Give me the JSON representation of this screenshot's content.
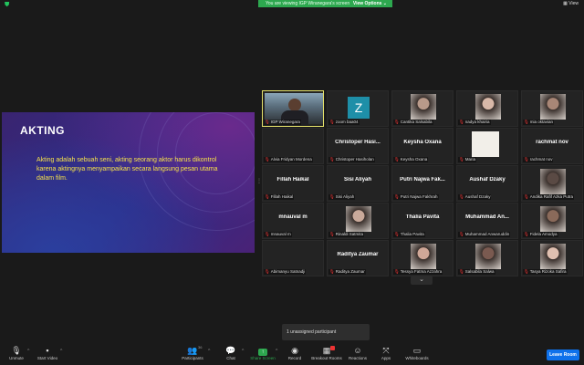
{
  "topbar": {
    "banner_text": "You are viewing IGP Wiranegara's screen",
    "view_options": "View Options ⌄",
    "view_label": "View"
  },
  "slide": {
    "title": "AKTING",
    "body": "Akting adalah sebuah seni, akting seorang aktor harus dikontrol karena aktingnya menyampaikan secara langsung pesan utama dalam film."
  },
  "participants": [
    {
      "name": "IGP Wiranegara",
      "big": "",
      "kind": "cam"
    },
    {
      "name": "zoom baa04",
      "big": "",
      "kind": "z"
    },
    {
      "name": "Cantika Salsabila",
      "big": "",
      "kind": "photo"
    },
    {
      "name": "nadya khairia",
      "big": "",
      "kind": "photo"
    },
    {
      "name": "mia oktavian",
      "big": "",
      "kind": "photo"
    },
    {
      "name": "Alvia Fridyan Mordena",
      "big": "",
      "kind": "blank"
    },
    {
      "name": "Christoper Hasiholan",
      "big": "Christoper Hasi...",
      "kind": "text"
    },
    {
      "name": "Keysha Oxana",
      "big": "Keysha Oxana",
      "kind": "text"
    },
    {
      "name": "Maria",
      "big": "",
      "kind": "photo-light"
    },
    {
      "name": "rachmat nov",
      "big": "rachmat nov",
      "kind": "text"
    },
    {
      "name": "Fillah Haikal",
      "big": "Fillah Haikal",
      "kind": "text"
    },
    {
      "name": "Sisi Aliyah",
      "big": "Sisi Aliyah",
      "kind": "text"
    },
    {
      "name": "Putri Najwa Fakhrah",
      "big": "Putri Najwa Fak...",
      "kind": "text"
    },
    {
      "name": "Aushaf Dzaky",
      "big": "Aushaf Dzaky",
      "kind": "text"
    },
    {
      "name": "Andika Rafif Azka Putra",
      "big": "",
      "kind": "photo"
    },
    {
      "name": "mnauval m",
      "big": "mnauval m",
      "kind": "text"
    },
    {
      "name": "Rinaldi Satmita",
      "big": "",
      "kind": "photo"
    },
    {
      "name": "Thalia Pavita",
      "big": "Thalia Pavita",
      "kind": "text"
    },
    {
      "name": "Muhammad Anwaruddin",
      "big": "Muhammad An...",
      "kind": "text"
    },
    {
      "name": "Fidela Amodya",
      "big": "",
      "kind": "photo"
    },
    {
      "name": "Abimanyu Satnadji",
      "big": "",
      "kind": "blank"
    },
    {
      "name": "Raditya Zaumar",
      "big": "Raditya Zaumar",
      "kind": "text"
    },
    {
      "name": "Tessya Fatma Azzahra",
      "big": "",
      "kind": "photo"
    },
    {
      "name": "Salsabila Salwa",
      "big": "",
      "kind": "photo"
    },
    {
      "name": "Tasya Rizoka Safira",
      "big": "",
      "kind": "photo"
    }
  ],
  "toast": "1 unassigned participant",
  "toolbar": {
    "unmute": "Unmute",
    "start_video": "Start Video",
    "participants": "Participants",
    "participant_count": "36",
    "chat": "Chat",
    "share_screen": "Share Screen",
    "record": "Record",
    "breakout_rooms": "Breakout Rooms",
    "reactions": "Reactions",
    "apps": "Apps",
    "whiteboards": "Whiteboards",
    "leave": "Leave Room",
    "accent_share": "#2da84f",
    "accent_leave": "#0e71eb"
  },
  "icons": [
    "shield-icon",
    "mic-muted-icon",
    "video-off-icon",
    "participants-icon",
    "chat-icon",
    "share-screen-icon",
    "record-icon",
    "breakout-rooms-icon",
    "reactions-icon",
    "apps-icon",
    "whiteboards-icon",
    "chevron-down-icon"
  ]
}
